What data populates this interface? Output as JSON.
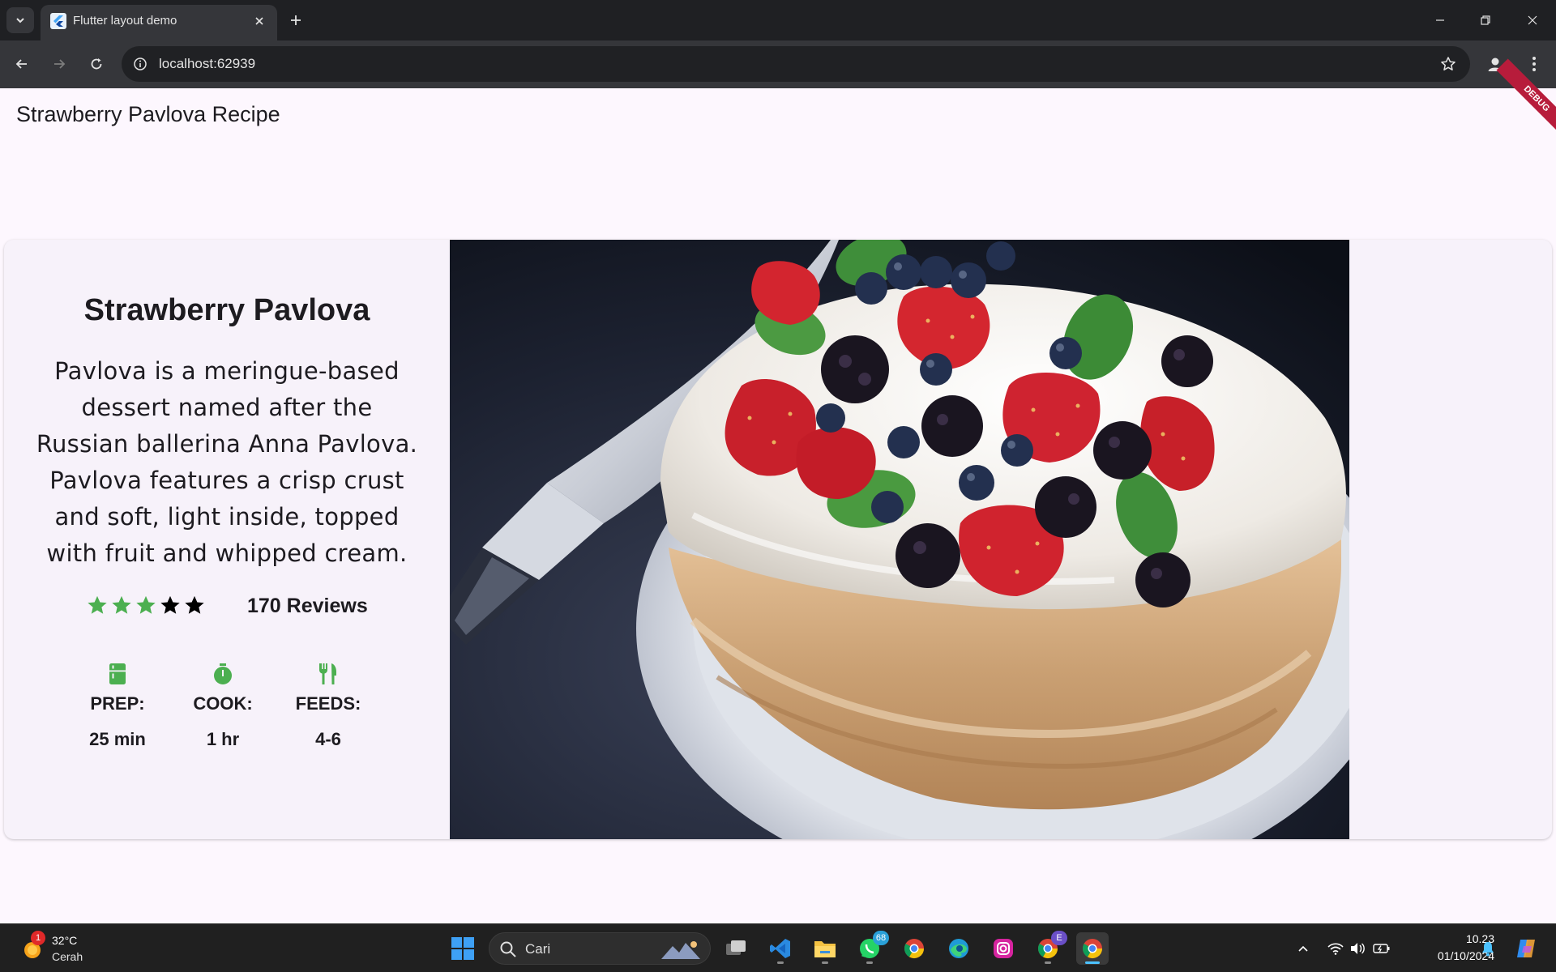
{
  "browser": {
    "tab_title": "Flutter layout demo",
    "url": "localhost:62939"
  },
  "app": {
    "title": "Strawberry Pavlova Recipe",
    "debug_banner": "DEBUG"
  },
  "recipe": {
    "title": "Strawberry Pavlova",
    "description": "Pavlova is a meringue-based dessert named after the Russian ballerina Anna Pavlova. Pavlova features a crisp crust and soft, light inside, topped with fruit and whipped cream.",
    "rating": {
      "stars_filled_green": 3,
      "stars_total": 5,
      "reviews": "170 Reviews"
    },
    "info": [
      {
        "icon": "kitchen-icon",
        "label": "PREP:",
        "value": "25 min"
      },
      {
        "icon": "timer-icon",
        "label": "COOK:",
        "value": "1 hr"
      },
      {
        "icon": "restaurant-icon",
        "label": "FEEDS:",
        "value": "4-6"
      }
    ],
    "colors": {
      "accent_green": "#4caf50",
      "star_dark": "#000000"
    }
  },
  "taskbar": {
    "weather": {
      "temp": "32°C",
      "condition": "Cerah",
      "badge": "1"
    },
    "search_placeholder": "Cari",
    "whatsapp_badge": "68",
    "chrome_profile_badge": "E",
    "time": "10.23",
    "date": "01/10/2024"
  }
}
